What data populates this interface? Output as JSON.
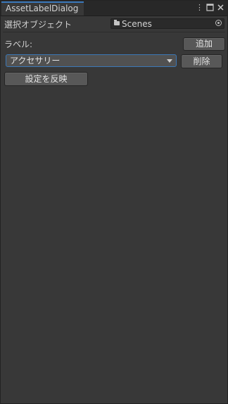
{
  "window": {
    "tab_title": "AssetLabelDialog"
  },
  "tab_icons": [
    "kebab-menu-icon",
    "maximize-icon",
    "close-icon"
  ],
  "object_row": {
    "label": "選択オブジェクト",
    "field_value": "Scenes",
    "field_icon": "folder-icon"
  },
  "label_row": {
    "label": "ラベル:",
    "add_button": "追加"
  },
  "dropdown_row": {
    "selected": "アクセサリー",
    "delete_button": "削除"
  },
  "apply_button": "設定を反映",
  "colors": {
    "background": "#383838",
    "tab_accent": "#3a79bb",
    "button": "#585858",
    "focus_border": "#3b78b7"
  }
}
